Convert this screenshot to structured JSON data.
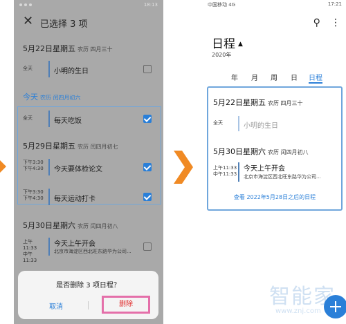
{
  "left": {
    "status_time": "18:13",
    "close_glyph": "✕",
    "title": "已选择 3 项",
    "groups": [
      {
        "date": "5月22日星期五",
        "lunar": "农历 四月三十"
      },
      {
        "date": "今天",
        "lunar": "农历 闰四月初六"
      },
      {
        "date": "5月29日星期五",
        "lunar": "农历 闰四月初七"
      },
      {
        "date": "5月30日星期六",
        "lunar": "农历 闰四月初八"
      }
    ],
    "events": [
      {
        "time1": "全天",
        "time2": "",
        "name": "小明的生日",
        "address": ""
      },
      {
        "time1": "全天",
        "time2": "",
        "name": "每天吃饭",
        "address": ""
      },
      {
        "time1": "下午3:30",
        "time2": "下午4:30",
        "name": "今天要体检论文",
        "address": ""
      },
      {
        "time1": "下午3:30",
        "time2": "下午4:30",
        "name": "每天运动打卡",
        "address": ""
      },
      {
        "time1": "上午11:33",
        "time2": "中午11:33",
        "name": "今天上午开会",
        "address": "北京市海淀区西北旺东路华为公司..."
      }
    ],
    "dialog": {
      "question": "是否删除 3 项日程？",
      "cancel": "取消",
      "delete": "删除"
    }
  },
  "right": {
    "status_left": "中国移动 4G",
    "status_right": "17:21",
    "title": "日程",
    "year": "2020年",
    "tabs": [
      "年",
      "月",
      "周",
      "日",
      "日程"
    ],
    "active_tab": "日程",
    "card": {
      "date1": "5月22日星期五",
      "lunar1": "农历 四月三十",
      "event1": {
        "time": "全天",
        "name": "小明的生日"
      },
      "date2": "5月30日星期六",
      "lunar2": "农历 闰四月初八",
      "event2": {
        "time1": "上午11:33",
        "time2": "中午11:33",
        "name": "今天上午开会",
        "address": "北京市海淀区西北旺东路华为公司..."
      },
      "more": "查看 2022年5月28日之后的日程"
    }
  },
  "watermark": {
    "text": "智能家",
    "url": "www.znj.com"
  },
  "colors": {
    "accent": "#2a7fd8",
    "arrow": "#f08a24",
    "highlight": "#e46fa9",
    "delete": "#e02a2a"
  }
}
